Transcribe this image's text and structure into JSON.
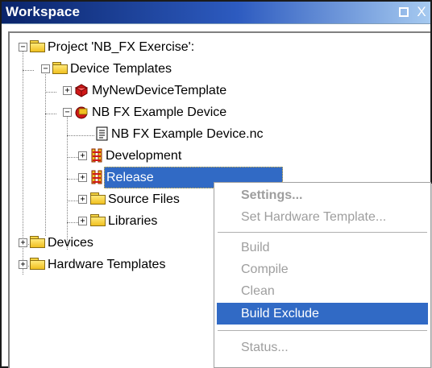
{
  "window": {
    "title": "Workspace",
    "float_glyph": "□",
    "close_glyph": "X"
  },
  "tree": {
    "project": "Project 'NB_FX Exercise':",
    "device_templates": "Device Templates",
    "my_new_device_template": "MyNewDeviceTemplate",
    "nb_fx_example_device": "NB FX Example Device",
    "nc_file": "NB FX Example Device.nc",
    "development": "Development",
    "release": "Release",
    "source_files": "Source Files",
    "libraries": "Libraries",
    "devices": "Devices",
    "hardware_templates": "Hardware Templates"
  },
  "context_menu": {
    "settings": "Settings...",
    "set_hardware_template": "Set Hardware Template...",
    "build": "Build",
    "compile": "Compile",
    "clean": "Clean",
    "build_exclude": "Build Exclude",
    "status": "Status..."
  },
  "colors": {
    "title_start": "#0a246a",
    "selection": "#316ac5",
    "disabled_text": "#9e9e9e"
  },
  "icons": {
    "folder": "folder-icon",
    "gem": "device-template-icon",
    "device": "device-icon",
    "file": "nc-file-icon",
    "config": "build-config-icon"
  }
}
